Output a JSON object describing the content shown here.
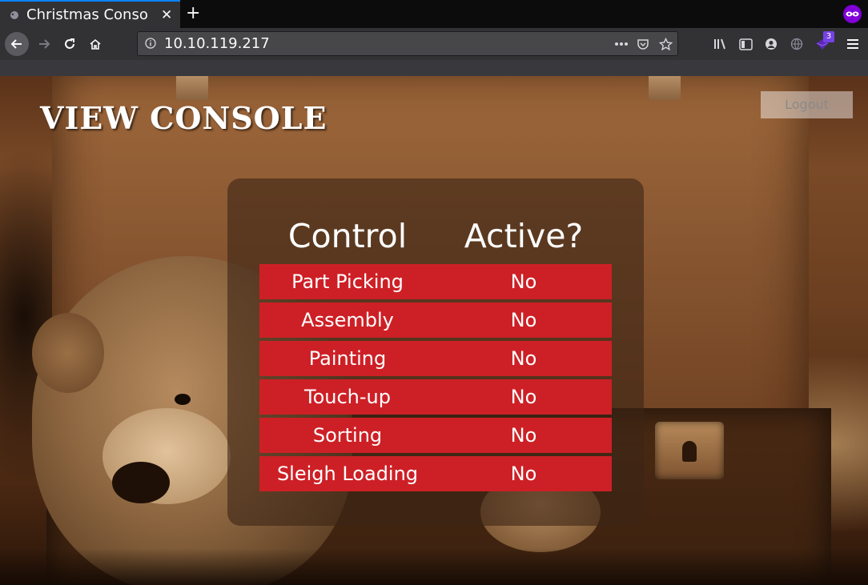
{
  "browser": {
    "tab_title": "Christmas Conso",
    "url": "10.10.119.217",
    "extension_badge": "3"
  },
  "page": {
    "title": "VIEW CONSOLE",
    "logout_label": "Logout"
  },
  "table": {
    "headers": [
      "Control",
      "Active?"
    ],
    "rows": [
      {
        "control": "Part Picking",
        "active": "No"
      },
      {
        "control": "Assembly",
        "active": "No"
      },
      {
        "control": "Painting",
        "active": "No"
      },
      {
        "control": "Touch-up",
        "active": "No"
      },
      {
        "control": "Sorting",
        "active": "No"
      },
      {
        "control": "Sleigh Loading",
        "active": "No"
      }
    ]
  },
  "colors": {
    "row_red": "#cd2026",
    "private_purple": "#8000d7",
    "tab_accent": "#0a84ff"
  }
}
